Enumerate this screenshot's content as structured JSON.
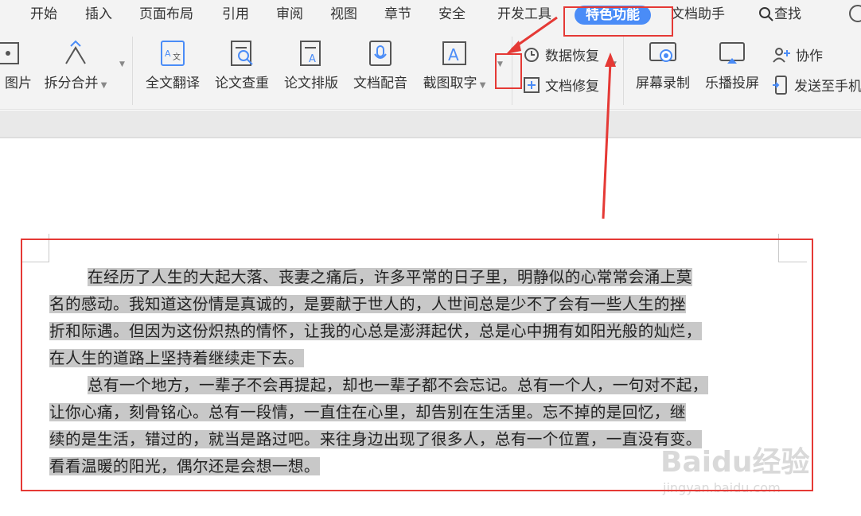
{
  "menu": {
    "tabs": [
      "开始",
      "插入",
      "页面布局",
      "引用",
      "审阅",
      "视图",
      "章节",
      "安全",
      "开发工具",
      "特色功能",
      "文档助手"
    ],
    "search_label": "查找"
  },
  "ribbon": {
    "picture_partial": "图片",
    "split_merge": "拆分合并",
    "full_translate": "全文翻译",
    "paper_check": "论文查重",
    "paper_format": "论文排版",
    "doc_dubbing": "文档配音",
    "screenshot_ocr": "截图取字",
    "data_recovery": "数据恢复",
    "doc_repair": "文档修复",
    "screen_record": "屏幕录制",
    "lebo_cast": "乐播投屏",
    "collaborate": "协作",
    "send_to_phone": "发送至手机"
  },
  "document": {
    "para1_line1": "在经历了人生的大起大落、丧妻之痛后，许多平常的日子里，明静似的心常常会涌上莫",
    "para1_line2": "名的感动。我知道这份情是真诚的，是要献于世人的，人世间总是少不了会有一些人生的挫",
    "para1_line3": "折和际遇。但因为这份炽热的情怀，让我的心总是澎湃起伏，总是心中拥有如阳光般的灿烂，",
    "para1_line4": "在人生的道路上坚持着继续走下去。",
    "para2_line1": "总有一个地方，一辈子不会再提起，却也一辈子都不会忘记。总有一个人，一句对不起，",
    "para2_line2": "让你心痛，刻骨铭心。总有一段情，一直住在心里，却告别在生活里。忘不掉的是回忆，继",
    "para2_line3": "续的是生活，错过的，就当是路过吧。来往身边出现了很多人，总有一个位置，一直没有变。",
    "para2_line4": "看看温暖的阳光，偶尔还是会想一想。"
  },
  "watermark": {
    "brand": "Baidu经验",
    "url": "jingyan.baidu.com"
  },
  "colors": {
    "accent": "#4a8cf7",
    "annotation_red": "#e53935",
    "selection_gray": "#c8c8c8"
  }
}
